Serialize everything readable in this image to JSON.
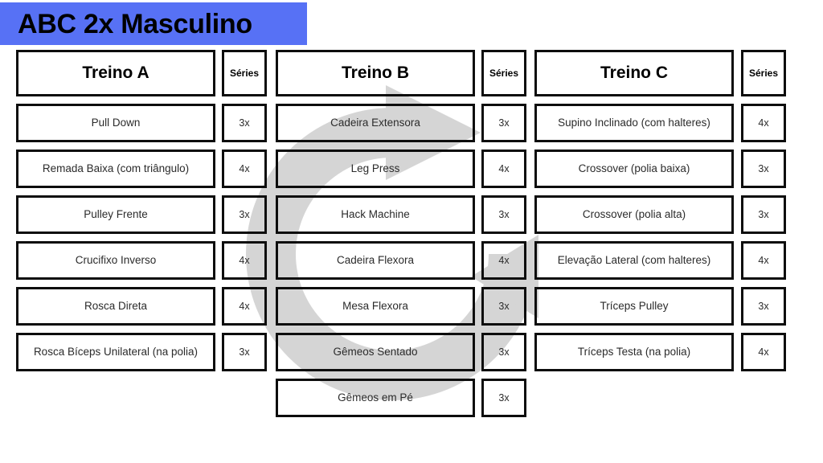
{
  "header": {
    "title": "ABC 2x Masculino",
    "banner_color": "#5771f5"
  },
  "watermark": {
    "icon": "circular-arrow-refresh-icon",
    "color": "#d5d5d5"
  },
  "columns": [
    {
      "title": "Treino A",
      "series_header": "Séries",
      "rows": [
        {
          "exercise": "Pull Down",
          "series": "3x"
        },
        {
          "exercise": "Remada Baixa (com triângulo)",
          "series": "4x"
        },
        {
          "exercise": "Pulley Frente",
          "series": "3x"
        },
        {
          "exercise": "Crucifixo Inverso",
          "series": "4x"
        },
        {
          "exercise": "Rosca Direta",
          "series": "4x"
        },
        {
          "exercise": "Rosca Bíceps Unilateral (na polia)",
          "series": "3x"
        }
      ]
    },
    {
      "title": "Treino B",
      "series_header": "Séries",
      "rows": [
        {
          "exercise": "Cadeira Extensora",
          "series": "3x"
        },
        {
          "exercise": "Leg Press",
          "series": "4x"
        },
        {
          "exercise": "Hack Machine",
          "series": "3x"
        },
        {
          "exercise": "Cadeira Flexora",
          "series": "4x"
        },
        {
          "exercise": "Mesa Flexora",
          "series": "3x"
        },
        {
          "exercise": "Gêmeos Sentado",
          "series": "3x"
        },
        {
          "exercise": "Gêmeos em Pé",
          "series": "3x"
        }
      ]
    },
    {
      "title": "Treino C",
      "series_header": "Séries",
      "rows": [
        {
          "exercise": "Supino Inclinado (com halteres)",
          "series": "4x"
        },
        {
          "exercise": "Crossover (polia baixa)",
          "series": "3x"
        },
        {
          "exercise": "Crossover (polia alta)",
          "series": "3x"
        },
        {
          "exercise": "Elevação Lateral (com halteres)",
          "series": "4x"
        },
        {
          "exercise": "Tríceps Pulley",
          "series": "3x"
        },
        {
          "exercise": "Tríceps Testa (na polia)",
          "series": "4x"
        }
      ]
    }
  ]
}
